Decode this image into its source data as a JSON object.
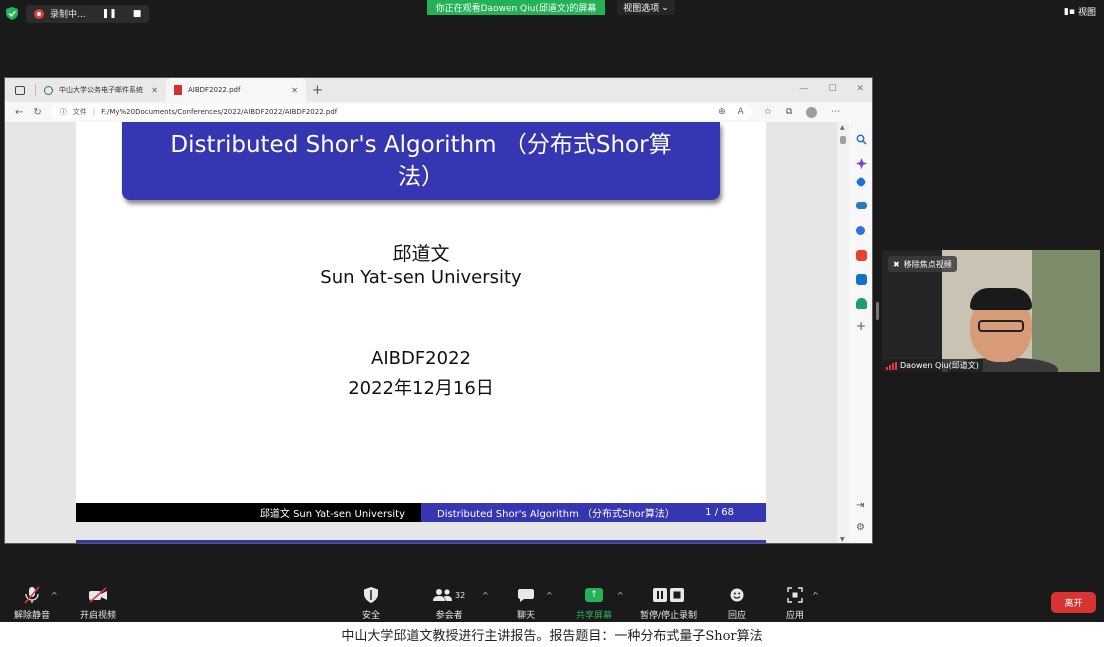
{
  "zoom": {
    "recording": {
      "label": "录制中...",
      "pause_icon": "pause-icon",
      "stop_icon": "stop-icon"
    },
    "viewing_banner": "你正在观看Daowen  Qiu(邱道文)的屏幕",
    "view_options": "视图选项",
    "view_button": "视图",
    "colors": {
      "share_green": "#23b257",
      "leave_red": "#d93434",
      "background": "#1a1a1a"
    }
  },
  "browser": {
    "tabs": [
      {
        "label": "中山大学公务电子邮件系统",
        "active": false
      },
      {
        "label": "AIBDF2022.pdf",
        "active": true
      }
    ],
    "address": {
      "file_label": "文件",
      "url": "F:/My%20Documents/Conferences/2022/AIBDF2022/AIBDF2022.pdf"
    }
  },
  "slide": {
    "title": "Distributed Shor's Algorithm （分布式Shor算法）",
    "author": "邱道文",
    "university": "Sun Yat-sen University",
    "conference": "AIBDF2022",
    "date": "2022年12月16日",
    "footer_left": "邱道文 Sun Yat-sen University",
    "footer_right": "Distributed Shor's Algorithm （分布式Shor算法）",
    "page": "1 / 68",
    "colors": {
      "title_bg": "#3636b2",
      "footer_left_bg": "#000000"
    }
  },
  "video": {
    "unpin_label": "移除焦点视频",
    "participant_name": "Daowen Qiu(邱道文)"
  },
  "toolbar": {
    "unmute": "解除静音",
    "start_video": "开启视频",
    "security": "安全",
    "participants": "参会者",
    "participant_count": "32",
    "chat": "聊天",
    "share_screen": "共享屏幕",
    "pause_recording": "暂停/停止录制",
    "reactions": "回应",
    "apps": "应用",
    "leave": "离开"
  },
  "caption": "中山大学邱道文教授进行主讲报告。报告题目：一种分布式量子Shor算法"
}
